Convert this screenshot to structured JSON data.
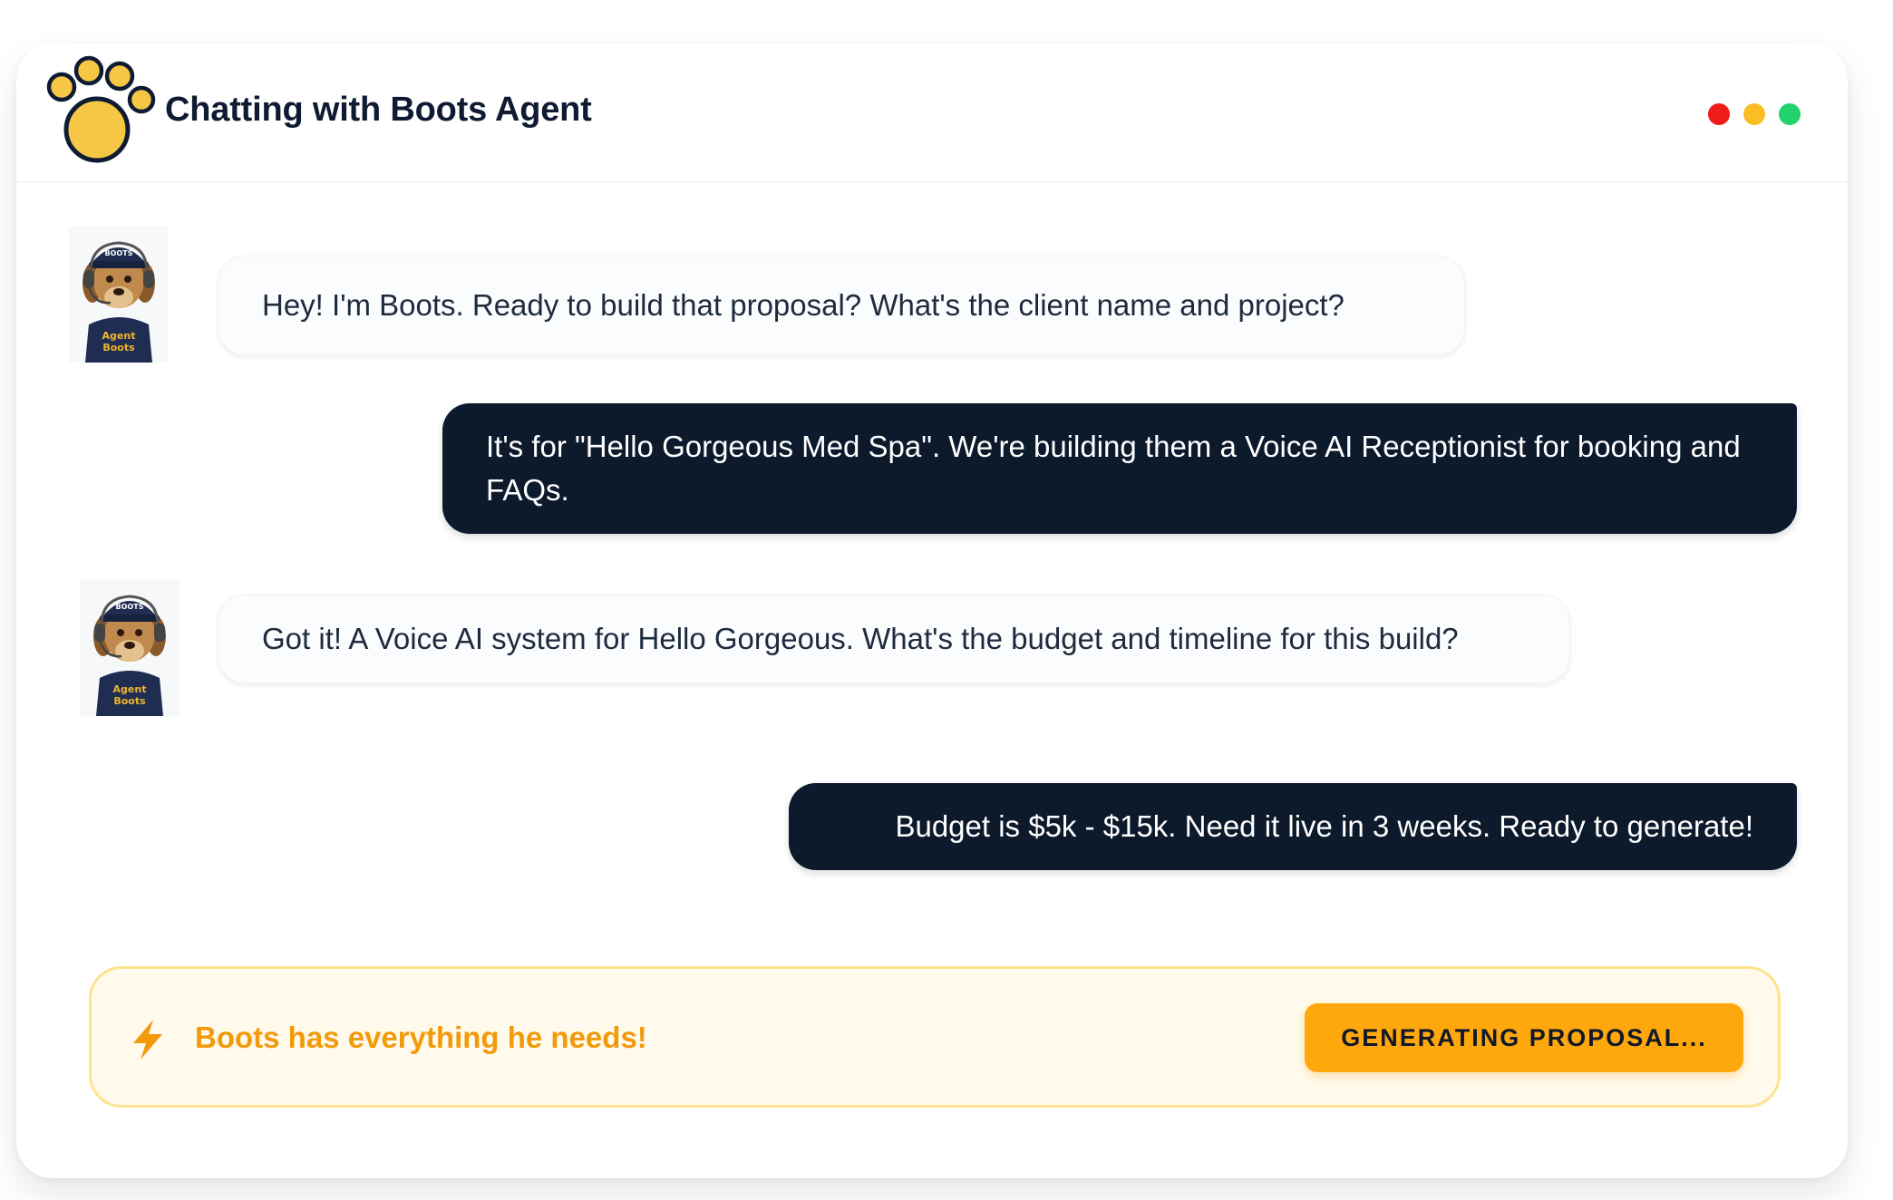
{
  "header": {
    "title": "Chatting with Boots Agent",
    "logo_icon": "paw-print-logo",
    "window_controls": [
      {
        "name": "close",
        "color": "#ef1c1c"
      },
      {
        "name": "minimize",
        "color": "#fbbd23"
      },
      {
        "name": "maximize",
        "color": "#22d36b"
      }
    ]
  },
  "agent": {
    "cap_text": "BOOTS",
    "shirt_text": "Agent Boots"
  },
  "messages": [
    {
      "from": "agent",
      "text": "Hey! I'm Boots. Ready to build that proposal? What's the client name and project?"
    },
    {
      "from": "user",
      "text": "It's for \"Hello Gorgeous Med Spa\". We're building them a Voice AI Receptionist for booking and FAQs."
    },
    {
      "from": "agent",
      "text": "Got it! A Voice AI system for Hello Gorgeous. What's the budget and timeline for this build?"
    },
    {
      "from": "user",
      "text": "Budget is $5k - $15k. Need it live in 3 weeks. Ready to generate!"
    }
  ],
  "status": {
    "icon": "lightning-bolt-icon",
    "text": "Boots has everything he needs!",
    "button_label": "GENERATING PROPOSAL...",
    "accent": "#f39a0b",
    "button_color": "#ffa80d"
  },
  "colors": {
    "user_bubble": "#0c1a2c",
    "agent_bubble": "#fbfcfe",
    "title": "#0f1b33"
  }
}
